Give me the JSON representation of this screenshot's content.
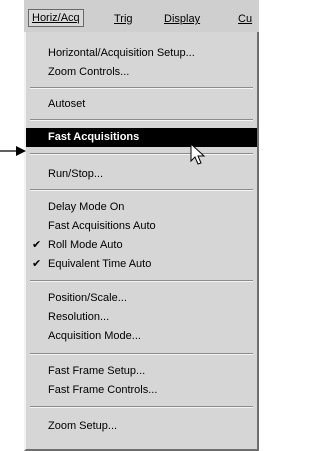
{
  "menubar": {
    "items": [
      "Horiz/Acq",
      "Trig",
      "Display",
      "Cu"
    ]
  },
  "menu": {
    "items": [
      {
        "label": "Horizontal/Acquisition Setup...",
        "checked": false
      },
      {
        "label": "Zoom Controls...",
        "checked": false
      },
      {
        "label": "Autoset",
        "checked": false
      },
      {
        "label": "Fast Acquisitions",
        "checked": false,
        "selected": true
      },
      {
        "label": "Run/Stop...",
        "checked": false
      },
      {
        "label": "Delay Mode On",
        "checked": false
      },
      {
        "label": "Fast Acquisitions Auto",
        "checked": false
      },
      {
        "label": "Roll Mode Auto",
        "checked": true
      },
      {
        "label": "Equivalent Time Auto",
        "checked": true
      },
      {
        "label": "Position/Scale...",
        "checked": false
      },
      {
        "label": "Resolution...",
        "checked": false
      },
      {
        "label": "Acquisition Mode...",
        "checked": false
      },
      {
        "label": "Fast Frame Setup...",
        "checked": false
      },
      {
        "label": "Fast Frame Controls...",
        "checked": false
      },
      {
        "label": "Zoom Setup...",
        "checked": false
      }
    ],
    "check_glyph": "✔"
  }
}
